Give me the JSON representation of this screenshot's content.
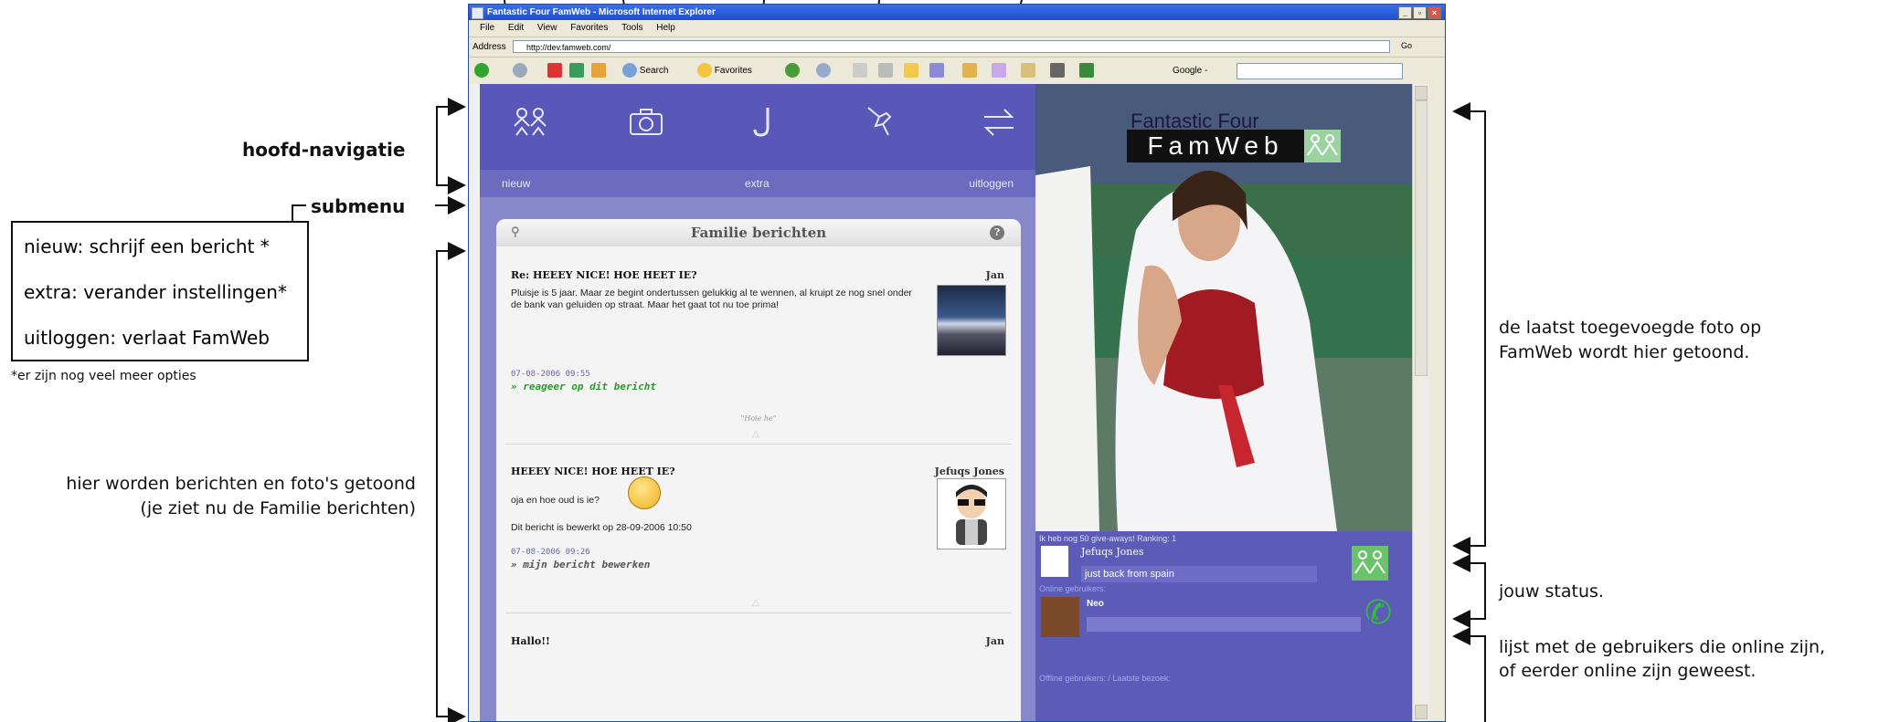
{
  "annotations": {
    "main_nav": "hoofd-navigatie",
    "submenu": "submenu",
    "legend": [
      "nieuw: schrijf een bericht  *",
      "extra: verander instellingen*",
      "uitloggen: verlaat FamWeb"
    ],
    "footnote": "*er zijn nog veel meer opties",
    "content_line1": "hier worden berichten en foto's getoond",
    "content_line2": "(je ziet nu de Familie berichten)",
    "photo_line1": "de laatst toegevoegde foto op",
    "photo_line2": "FamWeb wordt hier getoond.",
    "status": "jouw status.",
    "online_line1": "lijst met de gebruikers die online zijn,",
    "online_line2": "of eerder online zijn geweest."
  },
  "browser": {
    "title": "Fantastic Four FamWeb - Microsoft Internet Explorer",
    "menu": [
      "File",
      "Edit",
      "View",
      "Favorites",
      "Tools",
      "Help"
    ],
    "address_label": "Address",
    "url": "http://dev.famweb.com/",
    "go": "Go",
    "search": "Search",
    "favorites": "Favorites",
    "google": "Google -"
  },
  "app": {
    "submenu": {
      "left": "nieuw",
      "center": "extra",
      "right": "uitloggen"
    },
    "panel_title": "Familie berichten",
    "logo_line1": "Fantastic Four",
    "logo_line2": "FamWeb",
    "messages": [
      {
        "title": "Re: HEEEY NICE! HOE HEET IE?",
        "author": "Jan",
        "body": "Pluisje is 5 jaar. Maar ze begint ondertussen gelukkig al te wennen, al kruipt ze nog snel onder de bank van geluiden op straat. Maar het gaat tot nu toe prima!",
        "date": "07-08-2006 09:55",
        "link": "» reageer op dit bericht",
        "quote": "\"Hoie he\""
      },
      {
        "title": "HEEEY NICE! HOE HEET IE?",
        "author": "Jefuqs Jones",
        "body1": "oja en hoe oud is ie?",
        "body2": "Dit bericht is bewerkt op 28-09-2006 10:50",
        "date": "07-08-2006 09:26",
        "link": "» mijn bericht bewerken"
      },
      {
        "title": "Hallo!!",
        "author": "Jan"
      }
    ],
    "status_bar": "Ik heb nog 50 give-aways!  Ranking: 1",
    "user_name": "Jefuqs Jones",
    "user_status": "just back from spain",
    "online_label": "Online gebruikers:",
    "online_user": "Neo",
    "offline_label": "Offline gebruikers: / Laatste bezoek:"
  },
  "colors": {
    "nav_purple": "#5957b7",
    "content_purple": "#8887c9",
    "link_green": "#2a9a2a"
  }
}
